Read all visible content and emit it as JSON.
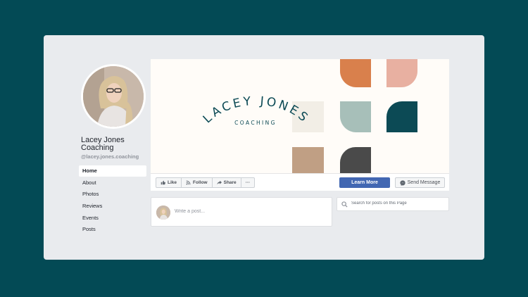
{
  "profile": {
    "name": "Lacey Jones Coaching",
    "handle": "@lacey.jones.coaching"
  },
  "nav": {
    "items": [
      {
        "label": "Home",
        "active": true
      },
      {
        "label": "About"
      },
      {
        "label": "Photos"
      },
      {
        "label": "Reviews"
      },
      {
        "label": "Events"
      },
      {
        "label": "Posts"
      }
    ]
  },
  "cover": {
    "logo_top": "LACEY JONES",
    "logo_bottom": "COACHING",
    "colors": {
      "orange": "#d9804c",
      "blush": "#e8b0a1",
      "cream": "#f2eee6",
      "sage": "#a7bfb9",
      "teal": "#0c4a55",
      "tan": "#c09f84",
      "charcoal": "#4a4a4a",
      "logo": "#0c4a55"
    }
  },
  "actions": {
    "like": "Like",
    "follow": "Follow",
    "share": "Share",
    "more": "···",
    "learn_more": "Learn More",
    "send_message": "Send Message"
  },
  "composer": {
    "placeholder": "Write a post..."
  },
  "search": {
    "placeholder": "Search for posts on this Page"
  },
  "icons": {
    "like": "thumbs-up-icon",
    "follow": "rss-icon",
    "share": "share-arrow-icon",
    "message": "messenger-icon",
    "search": "search-icon"
  }
}
